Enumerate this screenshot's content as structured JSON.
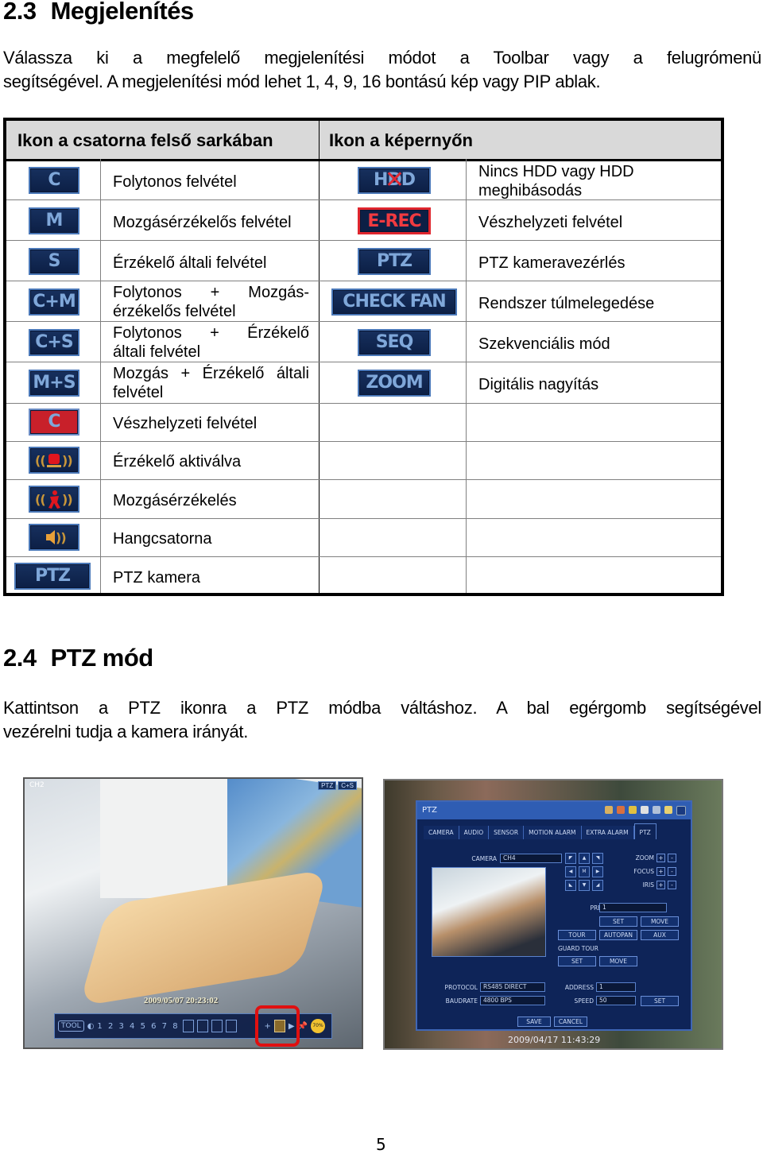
{
  "section_23": {
    "number": "2.3",
    "title": "Megjelenítés",
    "paragraph_lines": [
      "Válassza ki a megfelelő megjelenítési módot a Toolbar vagy a felugrómenü",
      "segítségével. A megjelenítési mód lehet 1, 4, 9, 16 bontású kép vagy PIP ablak."
    ]
  },
  "icon_table": {
    "headers": [
      "Ikon a csatorna felső sarkában",
      "Ikon a képernyőn"
    ],
    "channel_icons": [
      {
        "icon": "C",
        "style": "blue",
        "label": "Folytonos felvétel"
      },
      {
        "icon": "M",
        "style": "blue",
        "label": "Mozgásérzékelős felvétel"
      },
      {
        "icon": "S",
        "style": "blue",
        "label": "Érzékelő általi felvétel"
      },
      {
        "icon": "C+M",
        "style": "blue",
        "label_lines": [
          "Folytonos + Mozgás-",
          "érzékelős felvétel"
        ]
      },
      {
        "icon": "C+S",
        "style": "blue",
        "label_lines": [
          "Folytonos + Érzékelő",
          "általi felvétel"
        ]
      },
      {
        "icon": "M+S",
        "style": "blue",
        "label_lines": [
          "Mozgás + Érzékelő általi",
          "felvétel"
        ]
      },
      {
        "icon": "C",
        "style": "red",
        "label": "Vészhelyzeti felvétel"
      },
      {
        "icon": "siren-icon",
        "label": "Érzékelő aktiválva"
      },
      {
        "icon": "motion-person-icon",
        "label": "Mozgásérzékelés"
      },
      {
        "icon": "speaker-icon",
        "label": "Hangcsatorna"
      },
      {
        "icon": "PTZ",
        "style": "blue",
        "label": "PTZ kamera"
      }
    ],
    "screen_icons": [
      {
        "icon": "HDD",
        "style": "hdd-crossed",
        "label_lines": [
          "Nincs HDD vagy HDD",
          "meghibásodás"
        ]
      },
      {
        "icon": "E-REC",
        "style": "red-outline",
        "label": "Vészhelyzeti felvétel"
      },
      {
        "icon": "PTZ",
        "style": "blue",
        "label": "PTZ kameravezérlés"
      },
      {
        "icon": "CHECK FAN",
        "style": "blue",
        "label": "Rendszer túlmelegedése"
      },
      {
        "icon": "SEQ",
        "style": "blue",
        "label": "Szekvenciális mód"
      },
      {
        "icon": "ZOOM",
        "style": "blue",
        "label": "Digitális nagyítás"
      }
    ],
    "colors": {
      "badge_blue": "#0c1f45",
      "badge_border": "#4a78b8",
      "badge_text": "#7fa7d9",
      "badge_red": "#c8202a",
      "header_bg": "#d9d9d9"
    }
  },
  "section_24": {
    "number": "2.4",
    "title": "PTZ mód",
    "paragraph_lines": [
      "Kattintson a PTZ ikonra a PTZ módba váltáshoz. A bal egérgomb segítségével",
      "vezérelni tudja a kamera irányát."
    ]
  },
  "camera_screenshot": {
    "channel_label": "CH2",
    "tags": [
      "PTZ",
      "C+S"
    ],
    "timestamp": "2009/05/07 20:23:02",
    "toolbar": {
      "tool_label": "TOOL",
      "channel_numbers": "1 2 3 4 5 6 7 8",
      "percent": "70%"
    },
    "highlight_color": "#e01010"
  },
  "ptz_dialog": {
    "title": "PTZ",
    "tabs": [
      "CAMERA",
      "AUDIO",
      "SENSOR",
      "MOTION ALARM",
      "EXTRA ALARM",
      "PTZ"
    ],
    "active_tab": "PTZ",
    "camera_label": "CAMERA",
    "camera_value": "CH4",
    "pad_center": "M",
    "lens": [
      {
        "label": "ZOOM"
      },
      {
        "label": "FOCUS"
      },
      {
        "label": "IRIS"
      }
    ],
    "plus": "+",
    "minus": "-",
    "preset_label": "PRESET",
    "preset_value": "1",
    "set_label": "SET",
    "move_label": "MOVE",
    "tour_label": "TOUR",
    "autopan_label": "AUTOPAN",
    "aux_label": "AUX",
    "guard_tour_label": "GUARD TOUR",
    "protocol_label": "PROTOCOL",
    "protocol_value": "RS485 DIRECT",
    "baudrate_label": "BAUDRATE",
    "baudrate_value": "4800 BPS",
    "address_label": "ADDRESS",
    "address_value": "1",
    "speed_label": "SPEED",
    "speed_value": "50",
    "save_label": "SAVE",
    "cancel_label": "CANCEL",
    "timestamp": "2009/04/17 11:43:29"
  },
  "page_number": "5"
}
